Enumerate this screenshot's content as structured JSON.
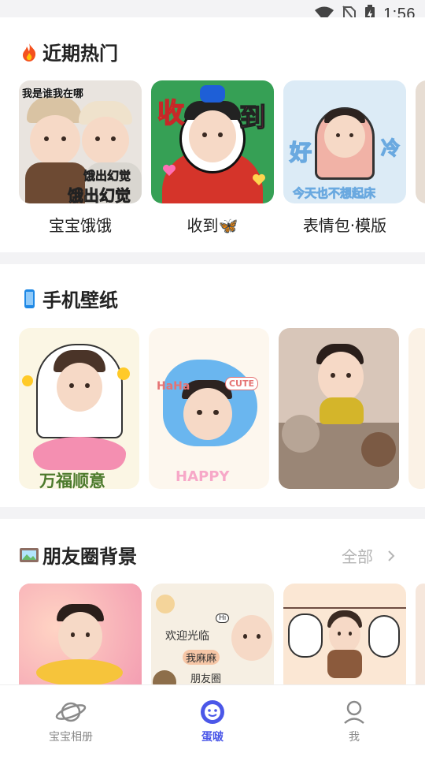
{
  "status": {
    "time": "1:56"
  },
  "sections": {
    "recent": {
      "title": "近期热门",
      "items": [
        {
          "label": "宝宝饿饿",
          "overlay_top": "我是谁我在哪",
          "overlay_bottom": "饿出幻觉"
        },
        {
          "label": "收到🦋",
          "overlay_left": "收",
          "overlay_right": "到"
        },
        {
          "label": "表情包·模版",
          "overlay_left": "好",
          "overlay_right": "冷",
          "overlay_bottom": "今天也不想起床"
        }
      ]
    },
    "wallpaper": {
      "title": "手机壁纸",
      "items": [
        {
          "overlay": "万福顺意"
        },
        {
          "overlay": "HaHa",
          "overlay2": "HAPPY",
          "overlay3": "CUTE"
        },
        {
          "overlay": ""
        }
      ]
    },
    "moments": {
      "title": "朋友圈背景",
      "more": "全部",
      "items": [
        {
          "overlay": ""
        },
        {
          "overlay": "欢迎光临",
          "overlay2": "我麻麻",
          "overlay3": "朋友圈",
          "overlay4": "Hi"
        },
        {
          "overlay": ""
        }
      ]
    }
  },
  "tabs": [
    {
      "label": "宝宝相册",
      "icon": "planet-icon"
    },
    {
      "label": "蛋啵",
      "icon": "smiley-icon",
      "active": true
    },
    {
      "label": "我",
      "icon": "user-icon"
    }
  ],
  "colors": {
    "accent": "#4b57e8",
    "inactive": "#8a8a8a"
  }
}
